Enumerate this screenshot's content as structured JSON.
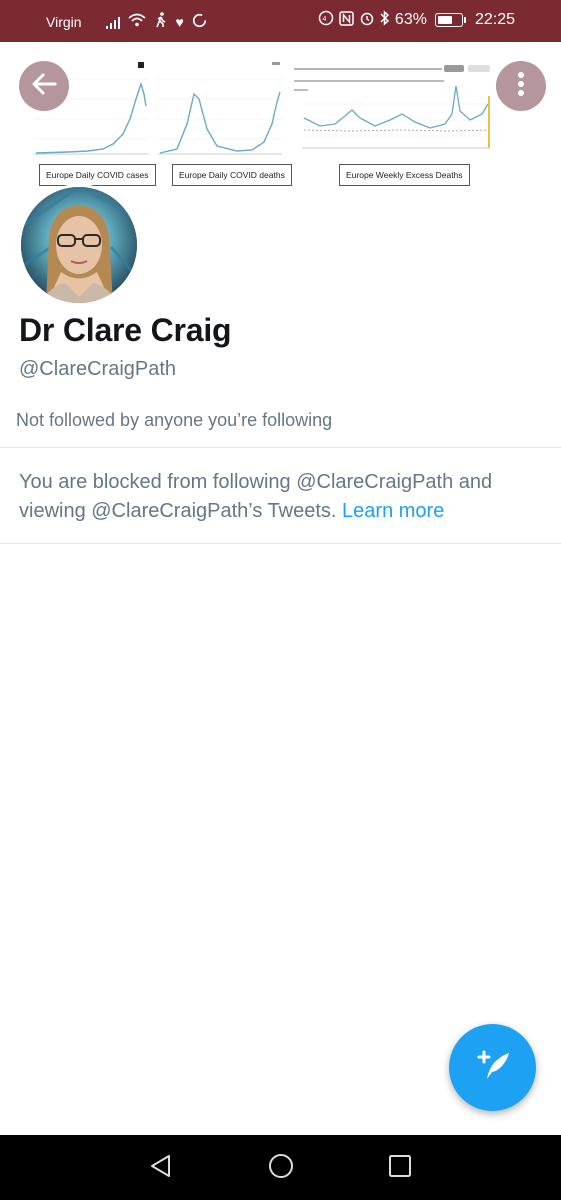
{
  "status_bar": {
    "carrier": "Virgin",
    "battery": "63%",
    "time": "22:25",
    "battery_level": 0.63,
    "color": "#7b2a32"
  },
  "banner": {
    "charts": [
      {
        "caption": "Europe Daily COVID cases"
      },
      {
        "caption": "Europe Daily COVID deaths"
      },
      {
        "caption": "Europe Weekly Excess Deaths"
      }
    ]
  },
  "header": {
    "back_icon": "arrow-left-icon",
    "more_icon": "more-vertical-icon"
  },
  "profile": {
    "name": "Dr Clare Craig",
    "handle": "@ClareCraigPath",
    "followed_by": "Not followed by anyone you’re following"
  },
  "blocked_notice": {
    "text": "You are blocked from following @ClareCraigPath and viewing @ClareCraigPath’s Tweets.",
    "link": "Learn more",
    "link_color": "#1da1f2"
  },
  "fab": {
    "icon": "compose-tweet-icon",
    "color": "#1da1f2"
  },
  "nav_bar": {
    "back_icon": "nav-back-icon",
    "home_icon": "nav-home-icon",
    "recents_icon": "nav-recents-icon"
  }
}
